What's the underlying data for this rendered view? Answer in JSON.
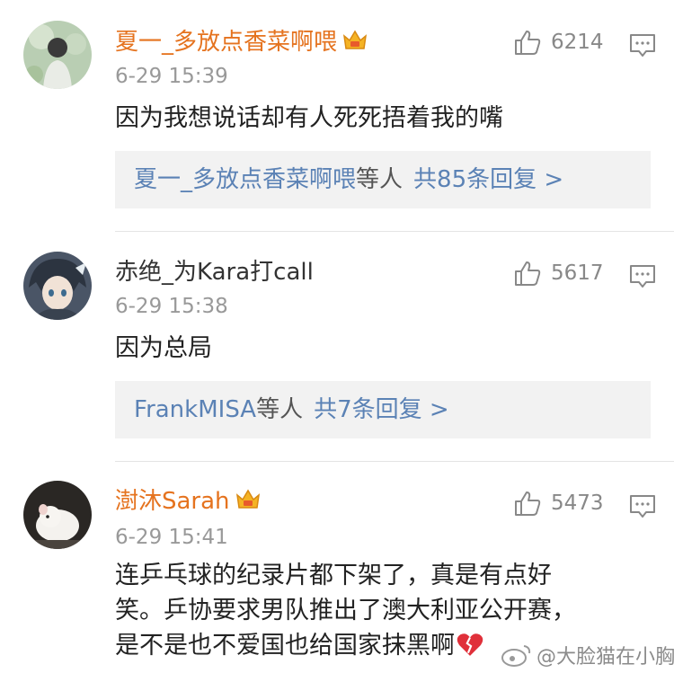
{
  "comments": [
    {
      "username": "夏一_多放点香菜啊喂",
      "vip": true,
      "time": "6-29 15:39",
      "likes": "6214",
      "text": "因为我想说话却有人死死捂着我的嘴",
      "reply_names": "夏一_多放点香菜啊喂",
      "reply_etc": "等人",
      "reply_total": "共85条回复 >"
    },
    {
      "username": "赤绝_为Kara打call",
      "vip": false,
      "time": "6-29 15:38",
      "likes": "5617",
      "text": "因为总局",
      "reply_names": "FrankMISA",
      "reply_etc": "等人",
      "reply_total": "共7条回复 >"
    },
    {
      "username": "澍沐Sarah",
      "vip": true,
      "time": "6-29 15:41",
      "likes": "5473",
      "text_lines": [
        "连乒乓球的纪录片都下架了，真是有点好",
        "笑。乒协要求男队推出了澳大利亚公开赛，",
        "是不是也不爱国也给国家抹黑啊"
      ]
    }
  ],
  "watermark": "@大脸猫在小胸",
  "colors": {
    "vip_name": "#e5731f",
    "link": "#5b82b5",
    "meta": "#999999"
  }
}
